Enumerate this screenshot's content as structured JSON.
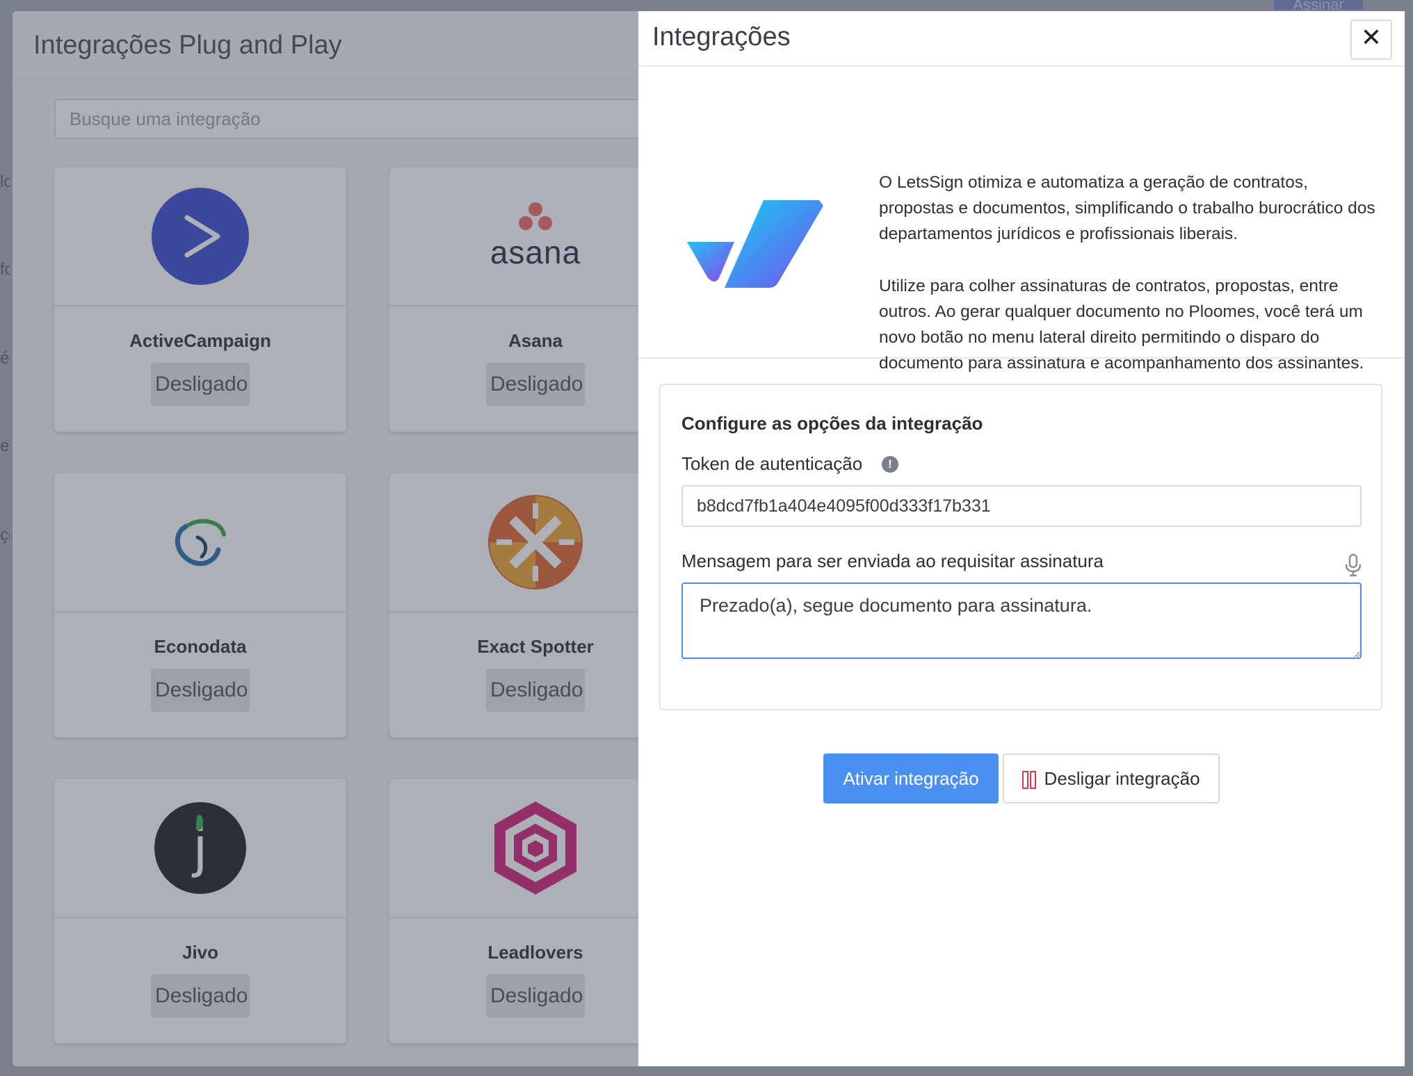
{
  "app": {
    "top_button_label": "Assinar",
    "edge_fragments": [
      "lo",
      "fo",
      "é-",
      "er",
      "çõ"
    ]
  },
  "left_modal": {
    "title": "Integrações Plug and Play",
    "search_placeholder": "Busque uma integração",
    "cards": [
      {
        "name": "ActiveCampaign",
        "status": "Desligado",
        "logo_text": ""
      },
      {
        "name": "Asana",
        "status": "Desligado",
        "logo_text": "asana"
      },
      {
        "name": "Econodata",
        "status": "Desligado",
        "logo_text": ""
      },
      {
        "name": "Exact Spotter",
        "status": "Desligado",
        "logo_text": ""
      },
      {
        "name": "Jivo",
        "status": "Desligado",
        "logo_text": "j"
      },
      {
        "name": "Leadlovers",
        "status": "Desligado",
        "logo_text": ""
      }
    ]
  },
  "drawer": {
    "title": "Integrações",
    "close_glyph": "✕",
    "description_1": "O LetsSign otimiza e automatiza a geração de contratos, propostas e documentos, simplificando o trabalho burocrático dos departamentos jurídicos e profissionais liberais.",
    "description_2": "Utilize para colher assinaturas de contratos, propostas, entre outros. Ao gerar qualquer documento no Ploomes, você terá um novo botão no menu lateral direito permitindo o disparo do documento para assinatura e acompanhamento dos assinantes.",
    "config": {
      "title": "Configure as opções da integração",
      "token_label": "Token de autenticação",
      "token_value": "b8dcd7fb1a404e4095f00d333f17b331",
      "message_label": "Mensagem para ser enviada ao requisitar assinatura",
      "message_value": "Prezado(a), segue documento para assinatura."
    },
    "activate_label": "Ativar integração",
    "deactivate_label": "Desligar integração"
  },
  "colors": {
    "primary": "#4a90f2",
    "danger": "#e0364a",
    "activecampaign": "#3a4fd3",
    "leadlovers": "#d4237a"
  }
}
